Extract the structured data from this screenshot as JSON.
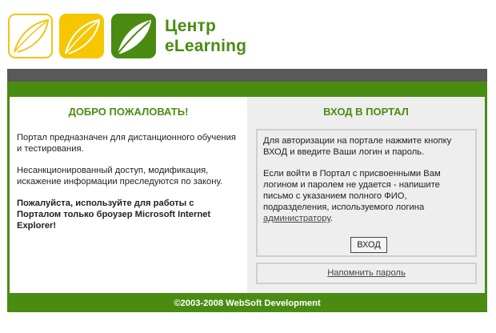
{
  "header": {
    "brand_line1": "Центр",
    "brand_line2": "eLearning",
    "logo_icons": [
      "leaf-outline-icon",
      "leaf-yellow-icon",
      "leaf-green-icon"
    ]
  },
  "welcome": {
    "title": "ДОБРО ПОЖАЛОВАТЬ!",
    "paragraph1": "Портал предназначен для дистанционного обучения и тестирования.",
    "paragraph2": "Несанкционированный доступ, модификация, искажение информации преследуются по закону.",
    "paragraph3": "Пожалуйста, используйте для работы с Порталом только броузер Microsoft Internet Explorer!"
  },
  "login": {
    "title": "ВХОД В ПОРТАЛ",
    "info1": "Для авторизации на портале нажмите кнопку ВХОД и введите Ваши логин и пароль.",
    "info2_prefix": "Если войти в Портал с присвоенными Вам логином и паролем не удается - напишите письмо с указанием полного ФИО, подразделения, используемого логина ",
    "admin_link": "администратору",
    "info2_suffix": ".",
    "button_label": "ВХОД",
    "remind_link": "Напомнить пароль"
  },
  "footer": {
    "copyright": "©2003-2008 WebSoft Development"
  },
  "colors": {
    "brand_green": "#4a8c12",
    "brand_yellow": "#f6c700",
    "bar_gray": "#595959",
    "panel_gray": "#eeeeee"
  }
}
